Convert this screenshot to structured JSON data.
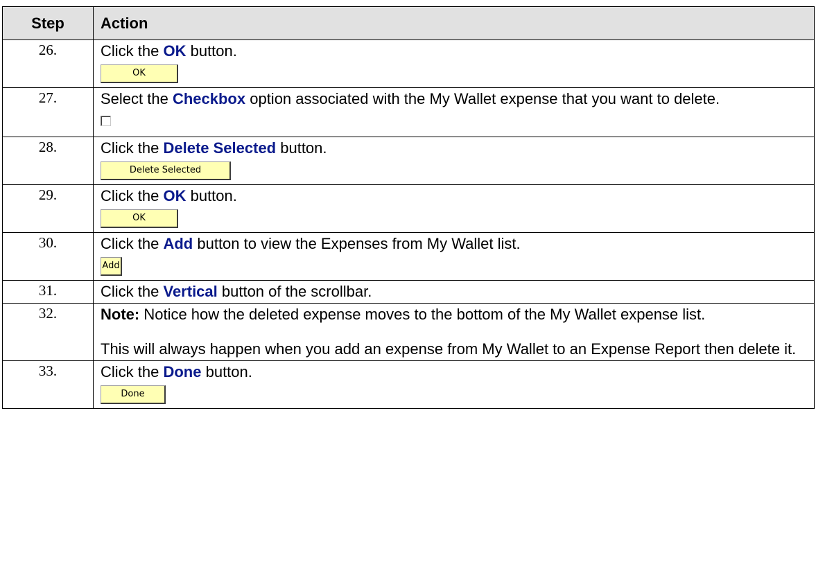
{
  "header": {
    "step": "Step",
    "action": "Action"
  },
  "rows": [
    {
      "num": "26.",
      "pre": "Click the ",
      "keyword": "OK",
      "post": " button.",
      "button": "OK"
    },
    {
      "num": "27.",
      "pre": "Select the ",
      "keyword": "Checkbox",
      "post": " option associated with the My Wallet expense that you want to delete."
    },
    {
      "num": "28.",
      "pre": "Click the ",
      "keyword": "Delete Selected",
      "post": " button.",
      "button": "Delete Selected"
    },
    {
      "num": "29.",
      "pre": "Click the ",
      "keyword": "OK",
      "post": " button.",
      "button": "OK"
    },
    {
      "num": "30.",
      "pre": "Click the ",
      "keyword": "Add",
      "post": " button to view the Expenses from My Wallet list.",
      "button": "Add"
    },
    {
      "num": "31.",
      "pre": "Click the ",
      "keyword": "Vertical",
      "post": " button of the scrollbar."
    },
    {
      "num": "32.",
      "keyword": "Note:",
      "post": " Notice how the deleted expense moves to the bottom of the My Wallet expense list.",
      "paragraph2": "This will always happen when you add an expense from My Wallet to an Expense Report then delete it."
    },
    {
      "num": "33.",
      "pre": "Click the ",
      "keyword": "Done",
      "post": " button.",
      "button": "Done"
    }
  ],
  "colors": {
    "keyword": "#0a1a8c",
    "header_bg": "#e1e1e1",
    "button_bg": "#ffffb4"
  }
}
